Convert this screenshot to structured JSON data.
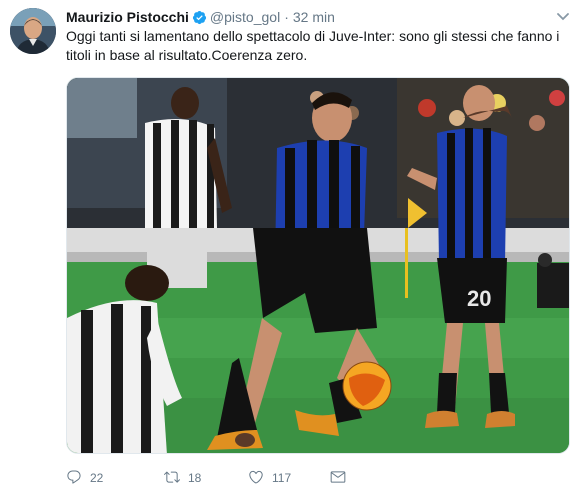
{
  "author": {
    "name": "Maurizio Pistocchi",
    "handle": "@pisto_gol",
    "separator": "·",
    "time": "32 min"
  },
  "tweet": {
    "text": "Oggi tanti si lamentano dello spettacolo di Juve-Inter: sono gli stessi che fanno i titoli in base al risultato.Coerenza zero."
  },
  "media": {
    "jersey_number": "20"
  },
  "actions": {
    "replies": "22",
    "retweets": "18",
    "likes": "117"
  },
  "colors": {
    "text": "#14171a",
    "secondary": "#657786",
    "verified": "#1da1f2",
    "border": "#e1e8ed"
  },
  "icons": [
    "caret-down-icon",
    "verified-badge-icon",
    "reply-icon",
    "retweet-icon",
    "like-icon",
    "direct-message-icon"
  ]
}
